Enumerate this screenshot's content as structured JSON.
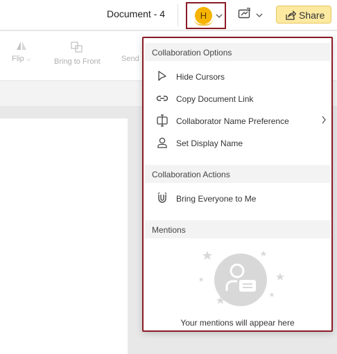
{
  "header": {
    "document_title": "Document - 4",
    "avatar_initial": "H",
    "share_label": "Share",
    "accent_color": "#8a1a24",
    "share_bg": "#fde9a0",
    "avatar_color": "#f6b400"
  },
  "toolbar": {
    "flip_label": "Flip",
    "bring_front_label": "Bring to Front",
    "send_label": "Send"
  },
  "panel": {
    "collab_options_title": "Collaboration Options",
    "items": [
      {
        "label": "Hide Cursors",
        "icon": "cursor-icon"
      },
      {
        "label": "Copy Document Link",
        "icon": "link-icon"
      },
      {
        "label": "Collaborator Name Preference",
        "icon": "name-preference-icon",
        "has_submenu": true
      },
      {
        "label": "Set Display Name",
        "icon": "user-icon"
      }
    ],
    "collab_actions_title": "Collaboration Actions",
    "actions": [
      {
        "label": "Bring Everyone to Me",
        "icon": "magnet-icon"
      }
    ],
    "mentions_title": "Mentions",
    "mentions_empty": "Your mentions will appear here"
  }
}
